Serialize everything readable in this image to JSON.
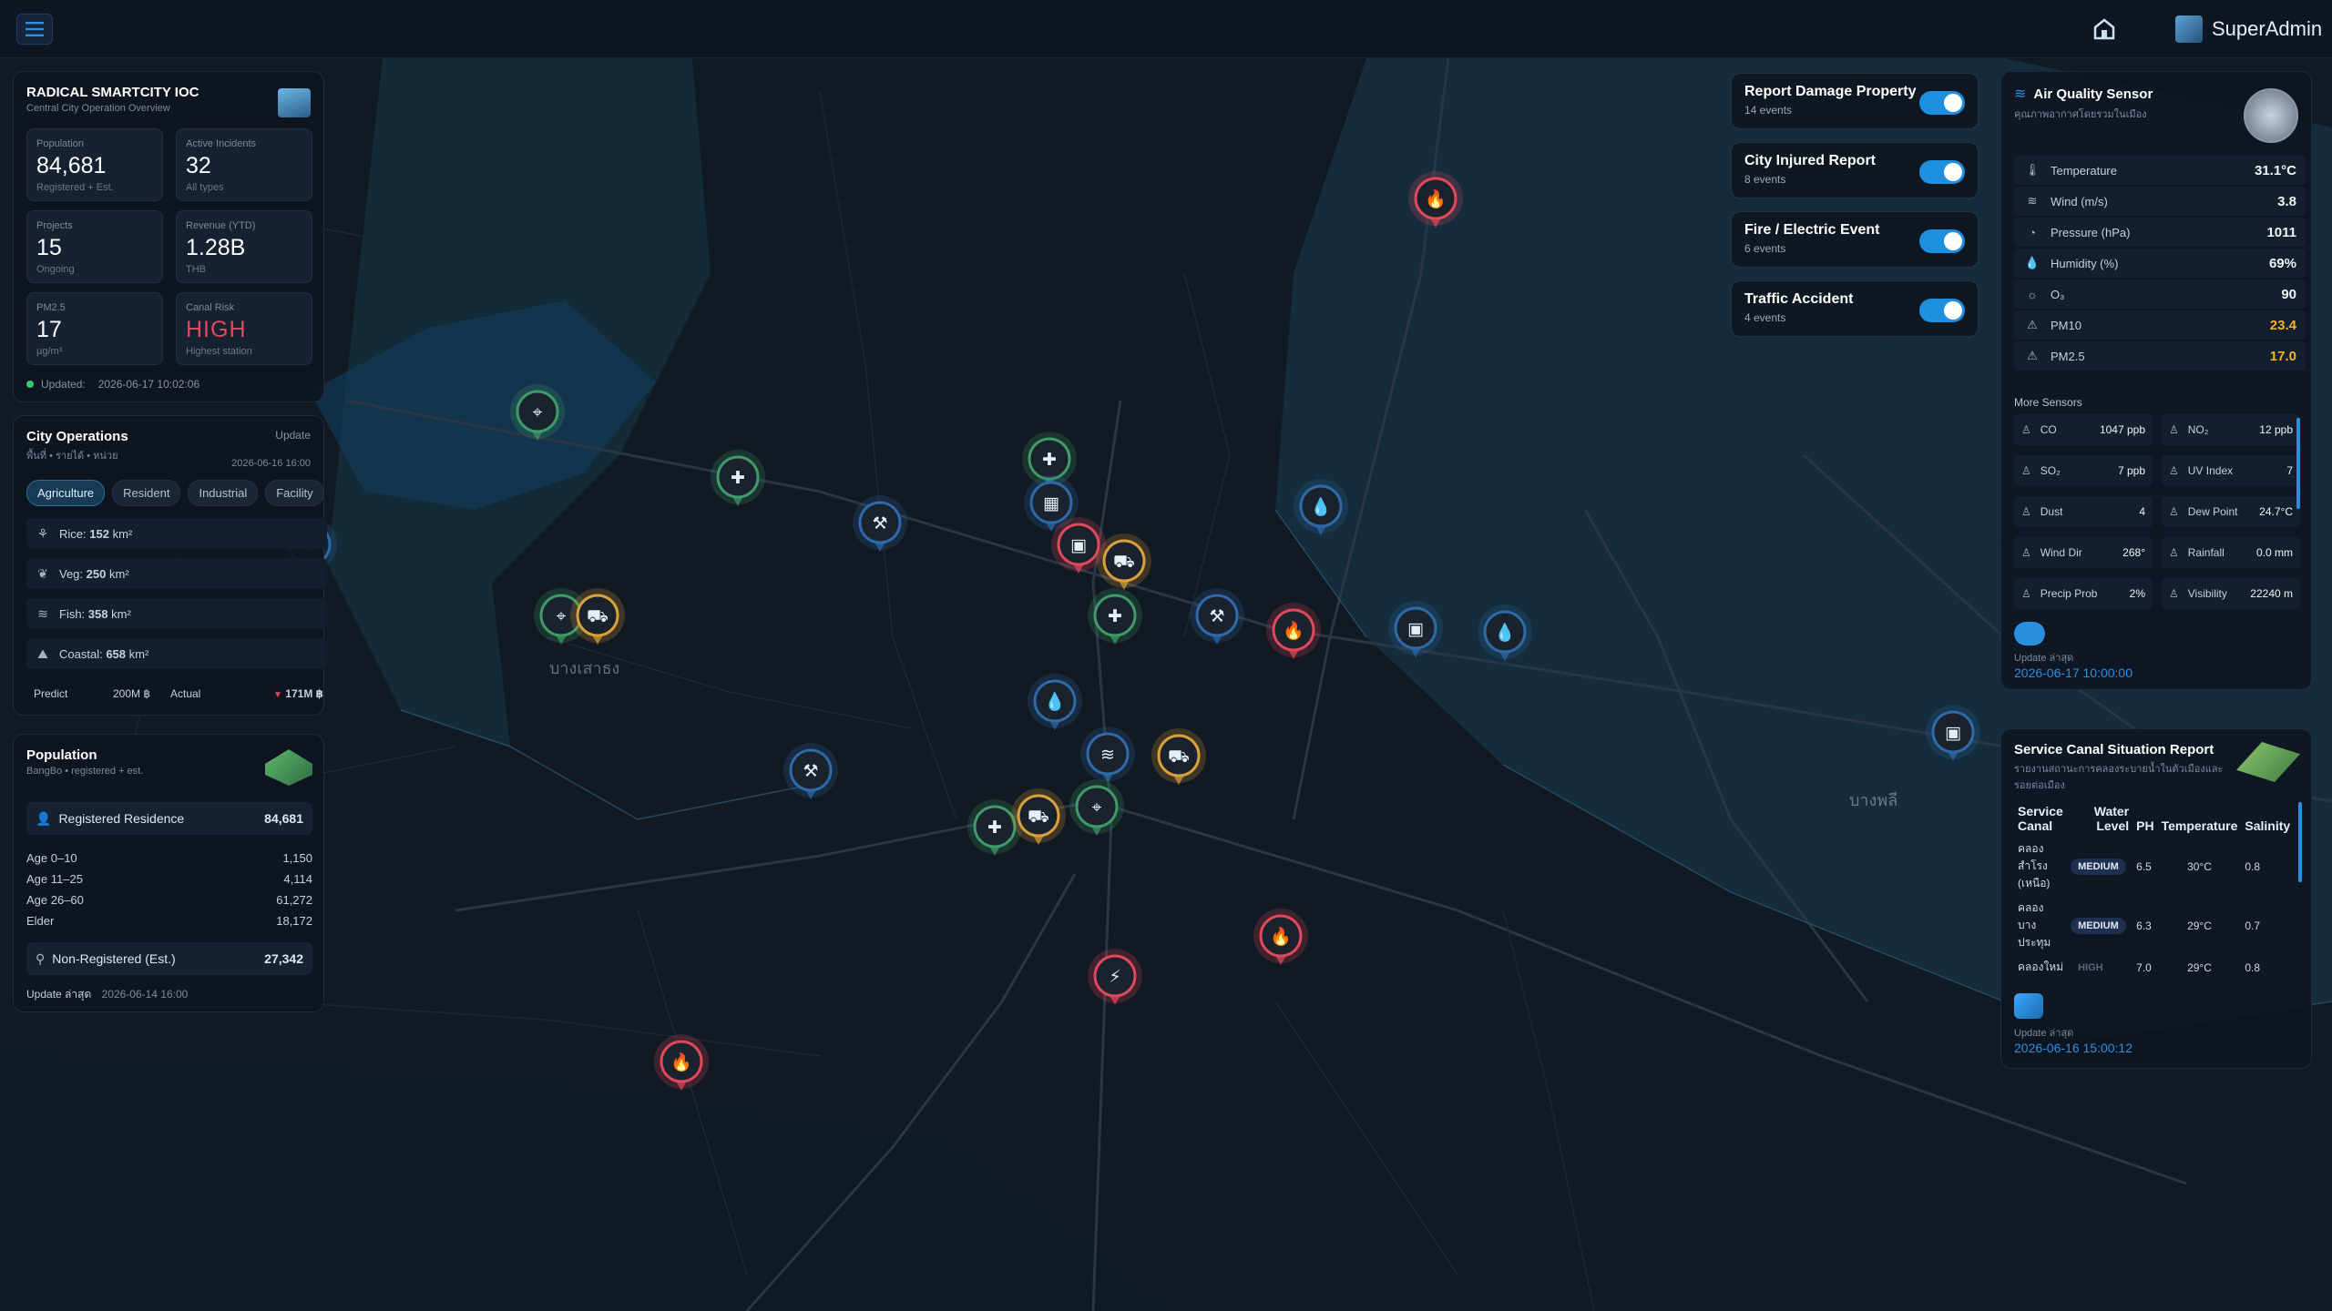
{
  "topbar": {
    "user": "SuperAdmin"
  },
  "overview": {
    "title": "RADICAL SMARTCITY IOC",
    "subtitle": "Central City Operation Overview",
    "stats": [
      {
        "label": "Population",
        "value": "84,681",
        "sub": "Registered + Est."
      },
      {
        "label": "Active Incidents",
        "value": "32",
        "sub": "All types"
      },
      {
        "label": "Projects",
        "value": "15",
        "sub": "Ongoing"
      },
      {
        "label": "Revenue (YTD)",
        "value": "1.28B",
        "sub": "THB"
      },
      {
        "label": "PM2.5",
        "value": "17",
        "sub": "µg/m³"
      },
      {
        "label": "Canal Risk",
        "value": "HIGH",
        "sub": "Highest station"
      }
    ],
    "updated_label": "Updated:",
    "updated_time": "2026-06-17 10:02:06"
  },
  "city_ops": {
    "title": "City Operations",
    "update_label": "Update",
    "subtitle": "พื้นที่ • รายได้ • หน่วย",
    "date": "2026-06-16 16:00",
    "tabs": [
      "Agriculture",
      "Resident",
      "Industrial",
      "Facility"
    ],
    "rows": [
      {
        "label": "Rice:",
        "value": "152",
        "unit": "km²"
      },
      {
        "label": "Veg:",
        "value": "250",
        "unit": "km²"
      },
      {
        "label": "Fish:",
        "value": "358",
        "unit": "km²"
      },
      {
        "label": "Coastal:",
        "value": "658",
        "unit": "km²"
      }
    ],
    "predict_label": "Predict",
    "predict_value": "200M ฿",
    "actual_label": "Actual",
    "actual_value": "171M ฿"
  },
  "population": {
    "title": "Population",
    "subtitle": "BangBo • registered + est.",
    "registered_label": "Registered Residence",
    "registered_value": "84,681",
    "ages": [
      {
        "label": "Age 0–10",
        "value": "1,150"
      },
      {
        "label": "Age 11–25",
        "value": "4,114"
      },
      {
        "label": "Age 26–60",
        "value": "61,272"
      },
      {
        "label": "Elder",
        "value": "18,172"
      }
    ],
    "nonreg_label": "Non-Registered (Est.)",
    "nonreg_value": "27,342",
    "update_label": "Update ล่าสุด",
    "update_time": "2026-06-14 16:00"
  },
  "layers": [
    {
      "title": "Report Damage Property",
      "count": "14 events"
    },
    {
      "title": "City Injured Report",
      "count": "8 events"
    },
    {
      "title": "Fire / Electric Event",
      "count": "6 events"
    },
    {
      "title": "Traffic Accident",
      "count": "4 events"
    }
  ],
  "air": {
    "title": "Air Quality Sensor",
    "subtitle": "คุณภาพอากาศโดยรวมในเมือง",
    "rows": [
      {
        "label": "Temperature",
        "value": "31.1°C"
      },
      {
        "label": "Wind (m/s)",
        "value": "3.8"
      },
      {
        "label": "Pressure (hPa)",
        "value": "1011"
      },
      {
        "label": "Humidity (%)",
        "value": "69%"
      },
      {
        "label": "O₃",
        "value": "90"
      },
      {
        "label": "PM10",
        "value": "23.4"
      },
      {
        "label": "PM2.5",
        "value": "17.0"
      }
    ],
    "more_label": "More Sensors",
    "more": [
      {
        "label": "CO",
        "value": "1047 ppb"
      },
      {
        "label": "NO₂",
        "value": "12 ppb"
      },
      {
        "label": "SO₂",
        "value": "7 ppb"
      },
      {
        "label": "UV Index",
        "value": "7"
      },
      {
        "label": "Dust",
        "value": "4"
      },
      {
        "label": "Dew Point",
        "value": "24.7°C"
      },
      {
        "label": "Wind Dir",
        "value": "268°"
      },
      {
        "label": "Rainfall",
        "value": "0.0 mm"
      },
      {
        "label": "Precip Prob",
        "value": "2%"
      },
      {
        "label": "Visibility",
        "value": "22240 m"
      }
    ],
    "update_label": "Update ล่าสุด",
    "update_time": "2026-06-17 10:00:00"
  },
  "canal": {
    "title": "Service Canal Situation Report",
    "subtitle": "รายงานสถานะการคลองระบายน้ำในตัวเมืองและรอยต่อเมือง",
    "headers": [
      "Service Canal",
      "Water Level",
      "PH",
      "Temperature",
      "Salinity"
    ],
    "rows": [
      {
        "name": "คลอง สำโรง (เหนือ)",
        "level": "MEDIUM",
        "ph": "6.5",
        "temp": "30°C",
        "sal": "0.8"
      },
      {
        "name": "คลอง บางประทุม",
        "level": "MEDIUM",
        "ph": "6.3",
        "temp": "29°C",
        "sal": "0.7"
      },
      {
        "name": "คลองใหม่",
        "level": "HIGH",
        "ph": "7.0",
        "temp": "29°C",
        "sal": "0.8"
      }
    ],
    "update_label": "Update ล่าสุด",
    "update_time": "2026-06-16 15:00:12"
  },
  "map": {
    "labels": [
      "บางเสาธง",
      "บางพลี"
    ],
    "colors": {
      "red": "#e0485b",
      "green": "#3f9a6a",
      "blue": "#2f6aa8",
      "amber": "#d9a13b"
    }
  }
}
